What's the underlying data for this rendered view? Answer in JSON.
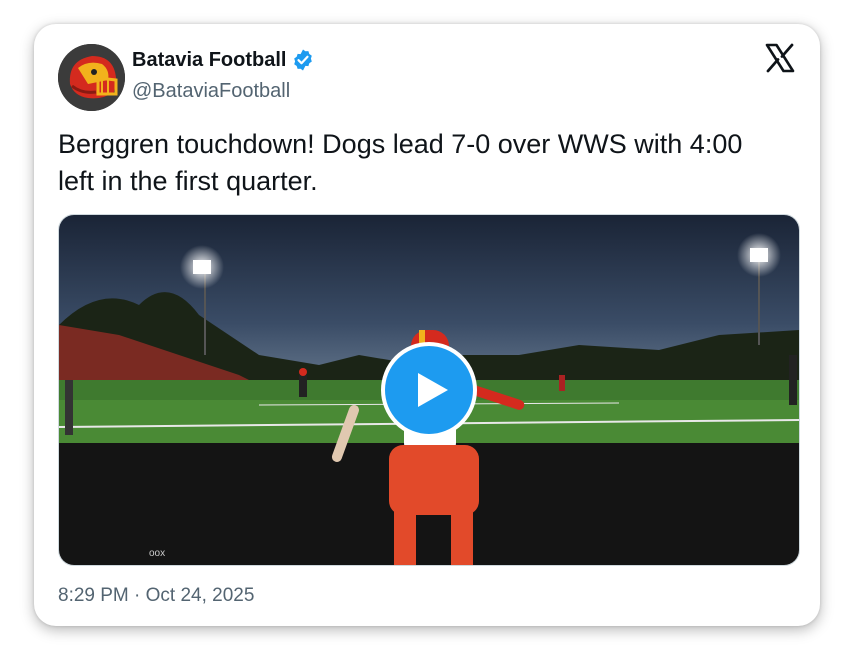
{
  "account": {
    "display_name": "Batavia Football",
    "handle": "@BataviaFootball",
    "verified": true,
    "avatar_icon": "bulldog-helmet-avatar"
  },
  "tweet": {
    "text_line1": "Berggren touchdown! Dogs lead 7-0 over WWS with 4:00",
    "text_line2": "left in the first quarter.",
    "timestamp": "8:29 PM · Oct 24, 2025"
  },
  "media": {
    "type": "video",
    "description_icon": "video-thumbnail",
    "play_icon": "play-icon"
  },
  "colors": {
    "accent": "#1d9bf0",
    "text_primary": "#0f1419",
    "text_secondary": "#536471"
  }
}
